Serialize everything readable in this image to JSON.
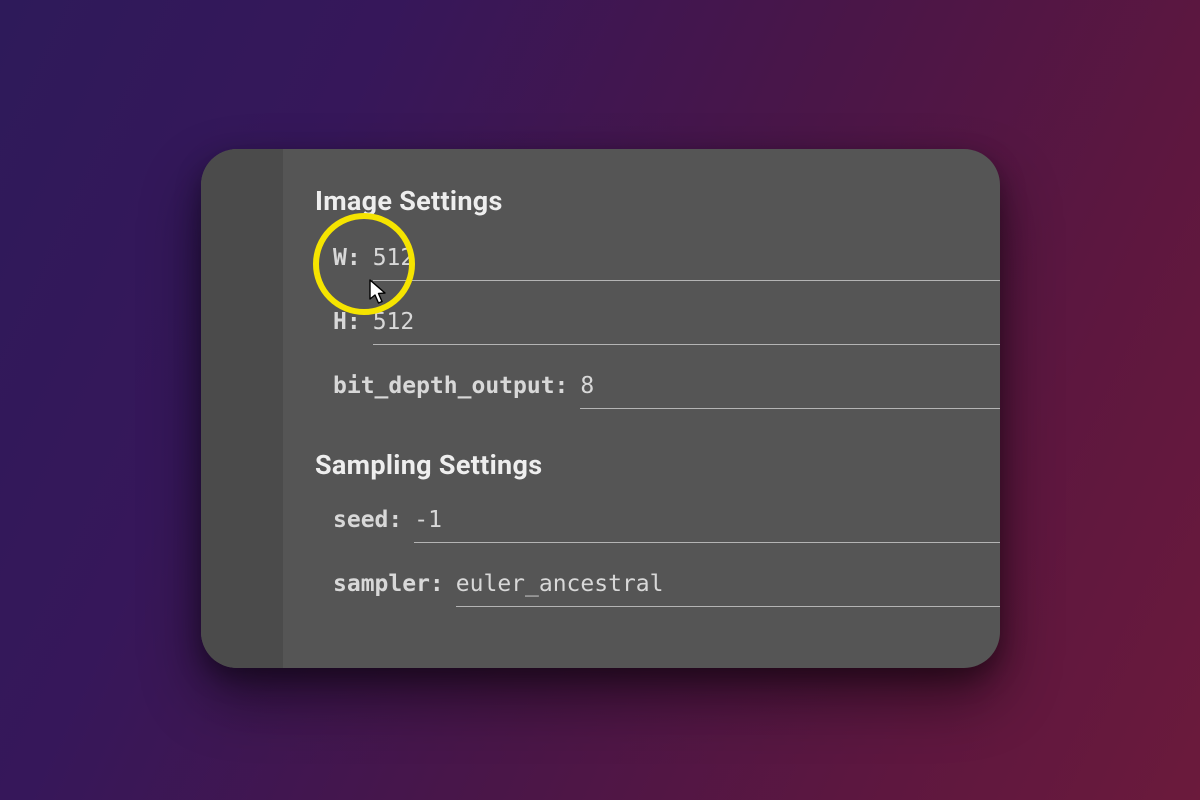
{
  "sections": {
    "image": {
      "title": "Image Settings",
      "fields": {
        "width": {
          "label": "W:",
          "value": "512"
        },
        "height": {
          "label": "H:",
          "value": "512"
        },
        "bit_depth_output": {
          "label": "bit_depth_output:",
          "value": "8"
        }
      }
    },
    "sampling": {
      "title": "Sampling Settings",
      "fields": {
        "seed": {
          "label": "seed:",
          "value": "-1"
        },
        "sampler": {
          "label": "sampler:",
          "value": "euler_ancestral"
        }
      }
    }
  },
  "highlight": {
    "target": "width-field",
    "circle_color": "#f5e400"
  }
}
